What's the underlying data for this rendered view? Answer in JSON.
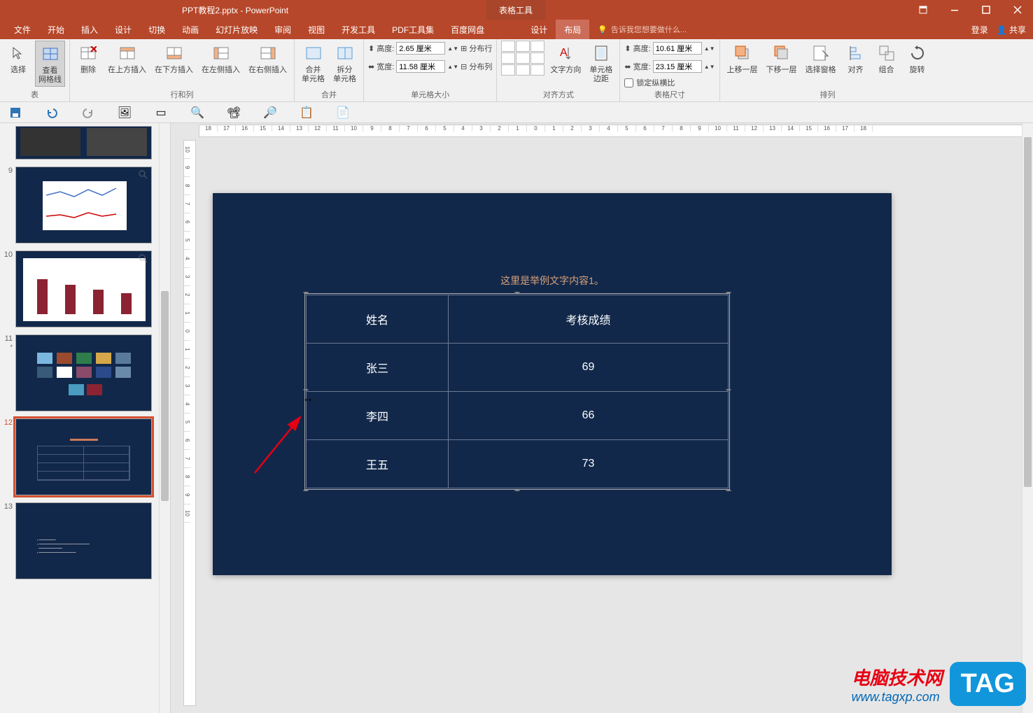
{
  "titlebar": {
    "filename": "PPT教程2.pptx - PowerPoint",
    "context_tool": "表格工具"
  },
  "tabs": {
    "file": "文件",
    "home": "开始",
    "insert": "插入",
    "design": "设计",
    "transition": "切换",
    "animation": "动画",
    "slideshow": "幻灯片放映",
    "review": "审阅",
    "view": "视图",
    "developer": "开发工具",
    "pdf": "PDF工具集",
    "baidu": "百度网盘",
    "table_design": "设计",
    "table_layout": "布局",
    "tell_me": "告诉我您想要做什么...",
    "login": "登录",
    "share": "共享"
  },
  "ribbon": {
    "groups": {
      "table": "表",
      "rows_cols": "行和列",
      "merge": "合并",
      "cell_size": "单元格大小",
      "alignment": "对齐方式",
      "table_size": "表格尺寸",
      "arrange": "排列"
    },
    "select": "选择",
    "gridlines": "查看\n网格线",
    "delete": "删除",
    "insert_above": "在上方插入",
    "insert_below": "在下方插入",
    "insert_left": "在左侧插入",
    "insert_right": "在右侧插入",
    "merge_cells": "合并\n单元格",
    "split_cells": "拆分\n单元格",
    "height_label": "高度:",
    "row_height": "2.65 厘米",
    "distribute_rows": "分布行",
    "width_label": "宽度:",
    "col_width": "11.58 厘米",
    "distribute_cols": "分布列",
    "text_dir": "文字方向",
    "cell_margins": "单元格\n边距",
    "table_height_label": "高度:",
    "table_height": "10.61 厘米",
    "table_width_label": "宽度:",
    "table_width": "23.15 厘米",
    "lock_aspect": "锁定纵横比",
    "bring_forward": "上移一层",
    "send_backward": "下移一层",
    "selection_pane": "选择窗格",
    "align": "对齐",
    "group": "组合",
    "rotate": "旋转"
  },
  "slides": {
    "9": "9",
    "10": "10",
    "11": "11",
    "11_star": "*",
    "12": "12",
    "13": "13"
  },
  "ruler_marks": [
    "18",
    "17",
    "16",
    "15",
    "14",
    "13",
    "12",
    "11",
    "10",
    "9",
    "8",
    "7",
    "6",
    "5",
    "4",
    "3",
    "2",
    "1",
    "0",
    "1",
    "2",
    "3",
    "4",
    "5",
    "6",
    "7",
    "8",
    "9",
    "10",
    "11",
    "12",
    "13",
    "14",
    "15",
    "16",
    "17",
    "18"
  ],
  "ruler_v_marks": [
    "10",
    "9",
    "8",
    "7",
    "6",
    "5",
    "4",
    "3",
    "2",
    "1",
    "0",
    "1",
    "2",
    "3",
    "4",
    "5",
    "6",
    "7",
    "8",
    "9",
    "10"
  ],
  "slide": {
    "title": "这里是举例文字内容1。",
    "table": {
      "h1": "姓名",
      "h2": "考核成绩",
      "r1c1": "张三",
      "r1c2": "69",
      "r2c1": "李四",
      "r2c2": "66",
      "r3c1": "王五",
      "r3c2": "73"
    }
  },
  "watermark": {
    "line1": "电脑技术网",
    "line2": "www.tagxp.com",
    "tag": "TAG"
  },
  "chart_data": {
    "type": "table",
    "title": "这里是举例文字内容1。",
    "columns": [
      "姓名",
      "考核成绩"
    ],
    "rows": [
      [
        "张三",
        69
      ],
      [
        "李四",
        66
      ],
      [
        "王五",
        73
      ]
    ]
  }
}
